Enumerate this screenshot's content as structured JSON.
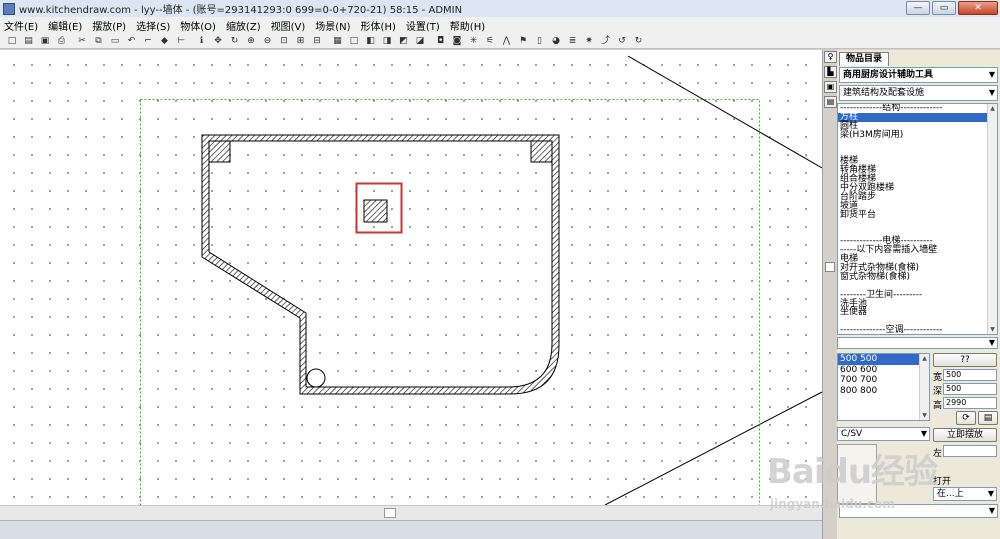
{
  "titlebar": {
    "title": "www.kitchendraw.com - lyy--墙体 - (账号=293141293:0 699=0-0+720-21) 58:15 - ADMIN",
    "minimize": "—",
    "maximize": "▭",
    "close": "✕"
  },
  "menu": [
    "文件(E)",
    "编辑(E)",
    "摆放(P)",
    "选择(S)",
    "物体(O)",
    "缩放(Z)",
    "视图(V)",
    "场景(N)",
    "形体(H)",
    "设置(T)",
    "帮助(H)"
  ],
  "toolbar": {
    "icons": [
      "new-file-icon",
      "open-folder-icon",
      "save-icon",
      "print-icon",
      "cut-icon",
      "copy-icon",
      "paste-icon",
      "undo-icon",
      "hammer-icon",
      "paint-icon",
      "dimension-icon",
      "info-icon",
      "move-icon",
      "rotate-icon",
      "zoom-in-icon",
      "zoom-out-icon",
      "zoom-window-icon",
      "zoom-all-icon",
      "zoom-prev-icon",
      "plan-view-icon",
      "box-icon",
      "cube-front-icon",
      "cube-left-icon",
      "cube-right-icon",
      "cube-back-icon",
      "camera-icon",
      "photo-icon",
      "light-icon",
      "measure-icon",
      "wall-cut-icon",
      "flag-icon",
      "door-icon",
      "globe-icon",
      "layer-icon",
      "lamp-icon",
      "stairs-icon",
      "rotate-left-icon",
      "rotate-right-icon"
    ],
    "glyphs": [
      "□",
      "▤",
      "▣",
      "⎙",
      "✂",
      "⧉",
      "▭",
      "↶",
      "⌐",
      "◆",
      "⊢",
      "ℹ",
      "✥",
      "↻",
      "⊕",
      "⊖",
      "⊡",
      "⊞",
      "⊟",
      "▦",
      "□",
      "◧",
      "◨",
      "◩",
      "◪",
      "◘",
      "◙",
      "✳",
      "⚟",
      "⋀",
      "⚑",
      "▯",
      "◕",
      "≣",
      "✷",
      "⤴",
      "↺",
      "↻"
    ]
  },
  "drawing": {
    "colors": {
      "selection": "#cc3333",
      "bounds": "#2fb82f",
      "wall": "#000000"
    }
  },
  "sidetabs": [
    "♀",
    "▙",
    "▣",
    "▤"
  ],
  "panel": {
    "tab": "物品目录",
    "catalog": "商用厨房设计辅助工具",
    "section": "建筑结构及配套设施",
    "items": [
      "-------------结构-------------",
      "方柱",
      "圆柱",
      "梁(H3M房间用)",
      "",
      "",
      "楼梯",
      "转角楼梯",
      "组合楼梯",
      "中分双跑楼梯",
      "台阶踏步",
      "坡道",
      "卸货平台",
      "",
      "",
      "-------------电梯----------",
      "-----以下内容需插入墙壁",
      "电梯",
      "对开式杂物梯(食梯)",
      "窗式杂物梯(食梯)",
      "",
      "--------卫生间---------",
      "洗手池",
      "坐便器",
      "",
      "--------------空调------------"
    ],
    "selected_index": 1,
    "sizes": [
      "500  500",
      "600  600",
      "700  700",
      "800  800"
    ],
    "selected_size": 0,
    "help_button": "??",
    "width_label": "宽:",
    "width_value": "500",
    "depth_label": "深:",
    "depth_value": "500",
    "height_label": "高:",
    "height_value": "2990",
    "style_combo": "C/SV",
    "place_now": "立即摆放",
    "left_label": "左",
    "open_label": "打开",
    "position_combo": "在...上"
  },
  "watermark": {
    "main": "Baidu经验",
    "sub": "jingyan.baidu.com"
  }
}
